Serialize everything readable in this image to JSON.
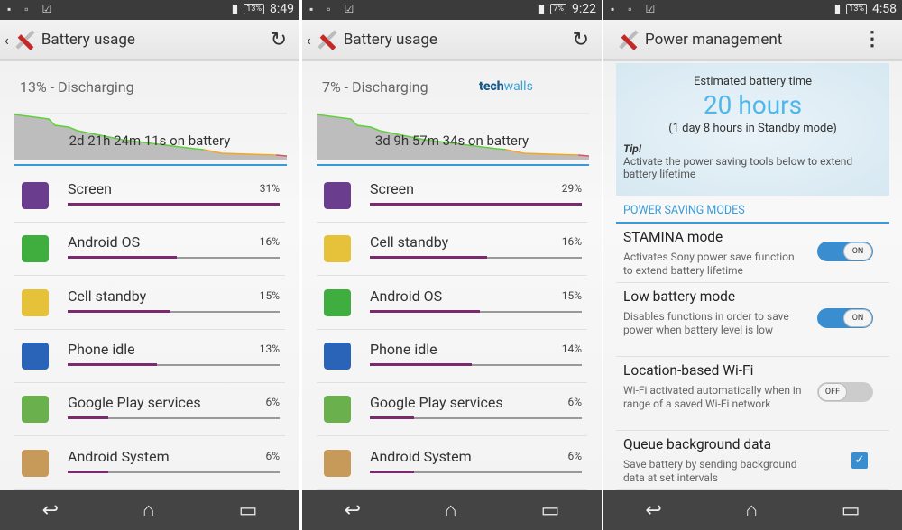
{
  "panels": [
    {
      "status": {
        "time": "8:49",
        "battery": "13%"
      },
      "title": "Battery usage",
      "discharging": "13% - Discharging",
      "on_battery": "2d 21h 24m 11s on battery",
      "items": [
        {
          "name": "Screen",
          "pct": "31%",
          "value": 31,
          "icon": "screen-icon"
        },
        {
          "name": "Android OS",
          "pct": "16%",
          "value": 16,
          "icon": "android-os-icon"
        },
        {
          "name": "Cell standby",
          "pct": "15%",
          "value": 15,
          "icon": "sim-card-icon"
        },
        {
          "name": "Phone idle",
          "pct": "13%",
          "value": 13,
          "icon": "phone-icon"
        },
        {
          "name": "Google Play services",
          "pct": "6%",
          "value": 6,
          "icon": "google-play-services-icon"
        },
        {
          "name": "Android System",
          "pct": "6%",
          "value": 6,
          "icon": "palette-icon"
        }
      ]
    },
    {
      "status": {
        "time": "9:22",
        "battery": "7%"
      },
      "title": "Battery usage",
      "discharging": "7% - Discharging",
      "on_battery": "3d 9h 57m 34s on battery",
      "watermark": {
        "a": "tech",
        "b": "walls"
      },
      "items": [
        {
          "name": "Screen",
          "pct": "29%",
          "value": 29,
          "icon": "screen-icon"
        },
        {
          "name": "Cell standby",
          "pct": "16%",
          "value": 16,
          "icon": "sim-card-icon"
        },
        {
          "name": "Android OS",
          "pct": "15%",
          "value": 15,
          "icon": "android-os-icon"
        },
        {
          "name": "Phone idle",
          "pct": "14%",
          "value": 14,
          "icon": "phone-icon"
        },
        {
          "name": "Google Play services",
          "pct": "6%",
          "value": 6,
          "icon": "google-play-services-icon"
        },
        {
          "name": "Android System",
          "pct": "6%",
          "value": 6,
          "icon": "palette-icon"
        }
      ]
    }
  ],
  "power": {
    "status": {
      "time": "4:58",
      "battery": "13%"
    },
    "title": "Power management",
    "estimate": {
      "heading": "Estimated battery time",
      "value": "20 hours",
      "standby": "(1 day 8 hours in Standby mode)",
      "tip_label": "Tip!",
      "tip": "Activate the power saving tools below to extend battery lifetime"
    },
    "section": "POWER SAVING MODES",
    "modes": [
      {
        "title": "STAMINA mode",
        "desc": "Activates Sony power save function to extend battery lifetime",
        "control": "toggle",
        "state": "ON"
      },
      {
        "title": "Low battery mode",
        "desc": "Disables functions in order to save power when battery level is low",
        "control": "toggle",
        "state": "ON"
      },
      {
        "title": "Location-based Wi-Fi",
        "desc": "Wi-Fi activated automatically when in range of a saved Wi-Fi network",
        "control": "toggle",
        "state": "OFF"
      },
      {
        "title": "Queue background data",
        "desc": "Save battery by sending background data at set intervals",
        "control": "checkbox",
        "state": "checked"
      }
    ]
  },
  "colors": {
    "accent": "#3a9ad9",
    "bar": "#7b2a6e",
    "chart_good": "#5fd03a",
    "chart_mid": "#f5a623",
    "chart_low": "#e05060"
  }
}
